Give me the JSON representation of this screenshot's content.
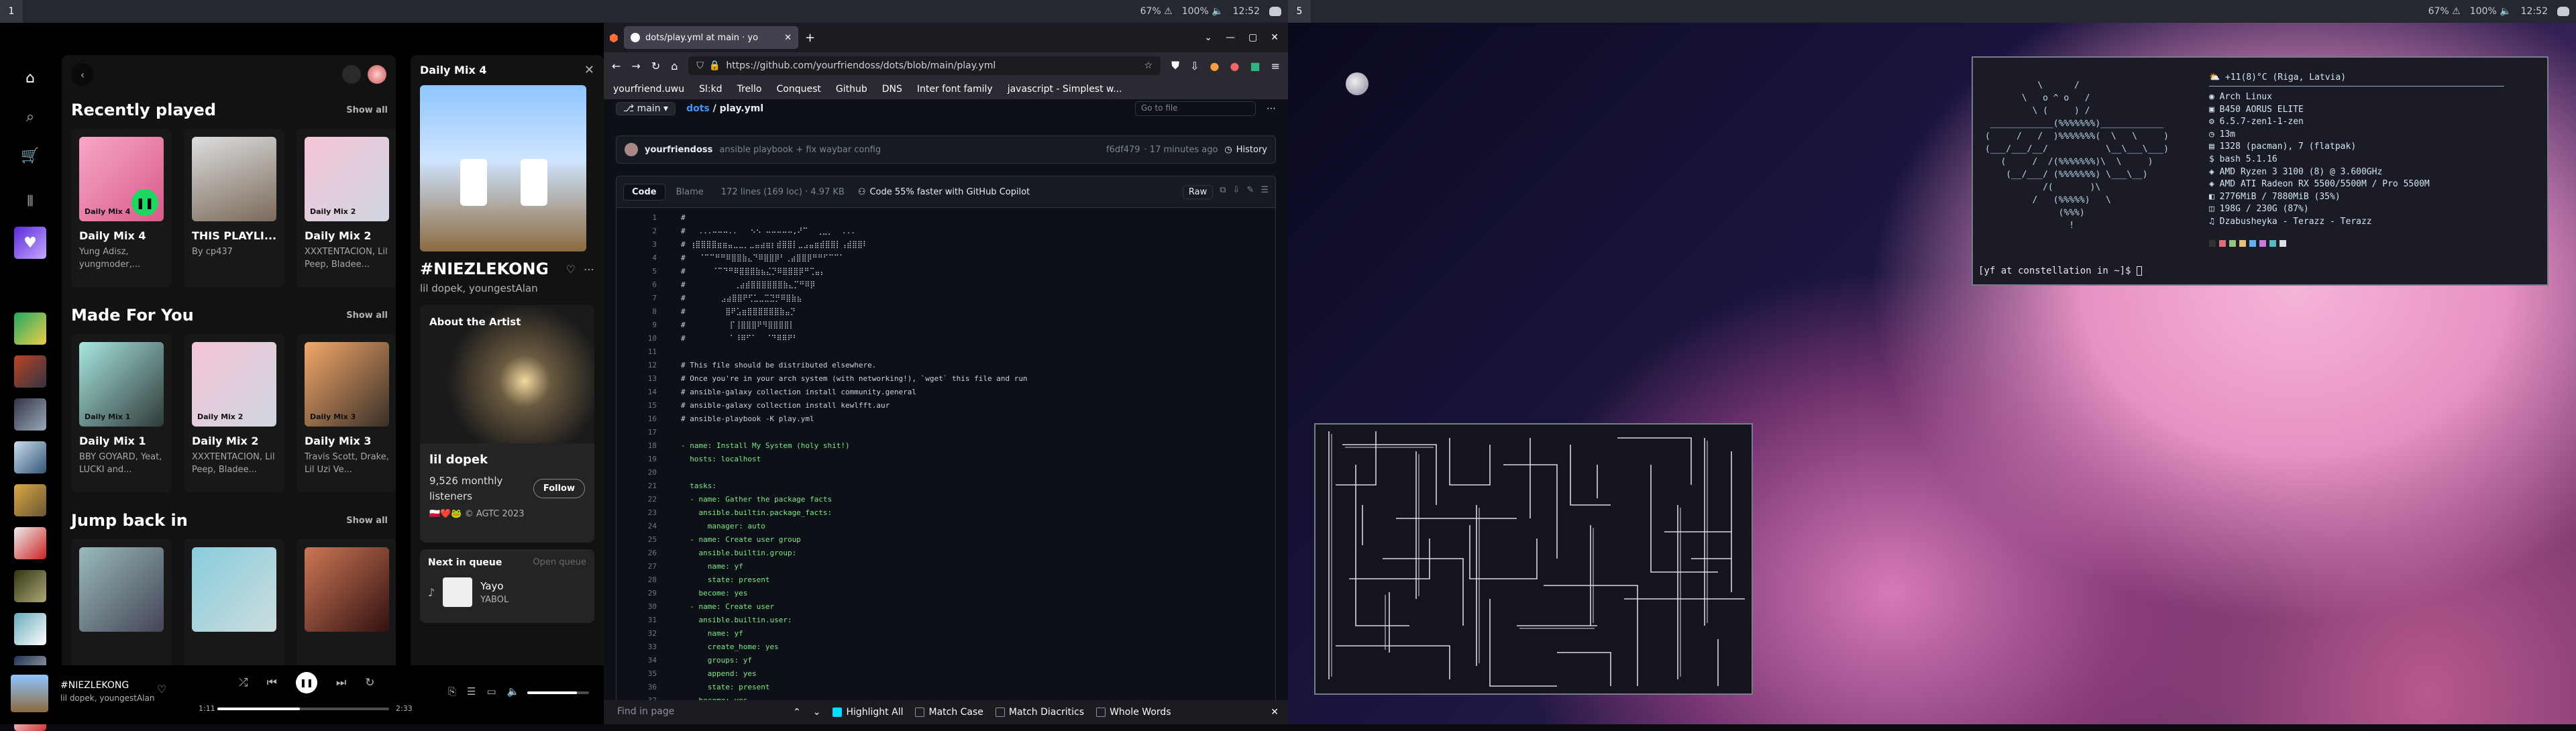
{
  "left_bar": {
    "workspace": "1",
    "battery": "67% ⚠",
    "volume": "100% 🔈",
    "clock": "12:52"
  },
  "right_bar": {
    "workspace": "5",
    "battery": "67% ⚠",
    "volume": "100% 🔈",
    "clock": "12:52"
  },
  "spotify": {
    "sections": {
      "recent": "Recently played",
      "made": "Made For You",
      "jump": "Jump back in",
      "show_all": "Show all"
    },
    "recent_cards": [
      {
        "title": "Daily Mix 4",
        "subtitle": "Yung Adisz, yungmoder,...",
        "art_label": "Daily Mix 4"
      },
      {
        "title": "THIS PLAYLI...",
        "subtitle": "By cp437",
        "art_label": ""
      },
      {
        "title": "Daily Mix 2",
        "subtitle": "XXXTENTACION, Lil Peep, Bladee...",
        "art_label": "Daily Mix 2"
      }
    ],
    "made_cards": [
      {
        "title": "Daily Mix 1",
        "subtitle": "BBY GOYARD, Yeat, LUCKI and...",
        "art_label": "Daily Mix 1"
      },
      {
        "title": "Daily Mix 2",
        "subtitle": "XXXTENTACION, Lil Peep, Bladee...",
        "art_label": "Daily Mix 2"
      },
      {
        "title": "Daily Mix 3",
        "subtitle": "Travis Scott, Drake, Lil Uzi Ve...",
        "art_label": "Daily Mix 3"
      }
    ],
    "now_playing_panel": {
      "header": "Daily Mix 4",
      "track": "#NIEZLEKONG",
      "artists": "lil dopek, youngestAlan",
      "about": "About the Artist",
      "artist_name": "lil dopek",
      "listeners": "9,526 monthly listeners",
      "follow": "Follow",
      "bio": "🇵🇱❤️🐸 © AGTC 2023",
      "queue_title": "Next in queue",
      "open_queue": "Open queue",
      "queue_track": "Yayo",
      "queue_artist": "YABOL"
    },
    "player": {
      "track": "#NIEZLEKONG",
      "artists": "lil dopek, youngestAlan",
      "elapsed": "1:11",
      "duration": "2:33",
      "progress": 0.48,
      "volume": 0.8
    }
  },
  "firefox": {
    "tab_title": "dots/play.yml at main · yo",
    "url": "https://github.com/yourfriendoss/dots/blob/main/play.yml",
    "bookmarks": [
      "yourfriend.uwu",
      "Sl:kd",
      "Trello",
      "Conquest",
      "Github",
      "DNS",
      "Inter font family",
      "javascript - Simplest w..."
    ],
    "branch": "main",
    "breadcrumb_repo": "dots",
    "breadcrumb_file": "play.yml",
    "search_placeholder": "Go to file",
    "commit_author": "yourfriendoss",
    "commit_message": "ansible playbook + fix waybar config",
    "commit_hash": "f6df479",
    "commit_time": "· 17 minutes ago",
    "history": "History",
    "tab_code": "Code",
    "tab_blame": "Blame",
    "file_meta": "172 lines (169 loc) · 4.97 KB",
    "copilot": "Code 55% faster with GitHub Copilot",
    "raw": "Raw",
    "code_lines": [
      "#",
      "#   ...⠤⠤⠤..   ⠢⠢ ⠤⠤⠤⠤⠤,⠜⠉  ⢀⣀⡀  ...",
      "# ⢰⣿⣿⣿⣿⣶⣶⣤⣀⣀⡀⣀⣤⣴⣶⡆⣾⣿⣿⡇⣀⣠⣤⣶⣾⣿⣿⡇⢠⣾⣿⣿⠇",
      "#   ⠈⠉⠉⠛⠛⠿⣿⣿⣷⣄⠙⠿⣿⣿⡿⠃⢀⣴⣿⣿⡿⠛⠛⠋⠉⠉⠁",
      "#      ⠈⠉⠙⠛⠿⣿⣿⣿⣷⣦⣌⡙⠿⣿⣿⣿⡿⠛⢉⣤⡄",
      "#           ⢀⣴⣾⣿⣿⣿⣿⣿⣿⣷⣄⡉⠛⠿⡿",
      "#        ⣠⣴⣿⣿⠟⢋⣁⣀⣉⣙⡛⠿⣿⣷⣦",
      "#         ⣿⠟⣡⣶⣿⣿⣿⣿⣿⣿⣷⣤⡙",
      "#          ⡏⢸⣿⣿⣿⠟⠻⣿⣿⣿⣿⡇",
      "#          ⠁⠸⠿⠋⠁  ⠈⠙⠿⠿⠟⠃",
      "",
      "# This file should be distributed elsewhere.",
      "# Once you're in your arch system (with networking!), `wget` this file and run",
      "# ansible-galaxy collection install community.general",
      "# ansible-galaxy collection install kewlfft.aur",
      "# ansible-playbook -K play.yml",
      "",
      "- name: Install My System (holy shit!)",
      "  hosts: localhost",
      "",
      "  tasks:",
      "  - name: Gather the package facts",
      "    ansible.builtin.package_facts:",
      "      manager: auto",
      "  - name: Create user group",
      "    ansible.builtin.group:",
      "      name: yf",
      "      state: present",
      "    become: yes",
      "  - name: Create user",
      "    ansible.builtin.user:",
      "      name: yf",
      "      create_home: yes",
      "      groups: yf",
      "      append: yes",
      "      state: present",
      "    become: yes"
    ],
    "findbar": {
      "placeholder": "Find in page",
      "highlight_all": "Highlight All",
      "match_case": "Match Case",
      "match_diacritics": "Match Diacritics",
      "whole_words": "Whole Words"
    }
  },
  "fetch": {
    "header": "+11(8)°C (Riga, Latvia)",
    "ascii": [
      "          \\      /",
      "       \\   o ^ o   /",
      "         \\ (     ) /",
      " ____________(%%%%%%%)____________",
      "(     /   /  )%%%%%%%(  \\   \\     )",
      "(___/___/__/           \\__\\___\\___)",
      "   (     /  /(%%%%%%%)\\  \\     )",
      "    (__/___/ (%%%%%%%) \\___\\__)",
      "           /(       )\\",
      "         /   (%%%%%)   \\",
      "              (%%%)",
      "                !"
    ],
    "info": [
      "Arch Linux",
      "B450 AORUS ELITE",
      "6.5.7-zen1-1-zen",
      "13m",
      "1328 (pacman), 7 (flatpak)",
      "bash 5.1.16",
      "AMD Ryzen 3 3100 (8) @ 3.600GHz",
      "AMD ATI Radeon RX 5500/5500M / Pro 5500M",
      "2776MiB / 7880MiB (35%)",
      "198G / 230G (87%)",
      "Dzabusheyka - Terazz - Terazz"
    ],
    "prompt": "[yf at constellation in ~]$"
  }
}
